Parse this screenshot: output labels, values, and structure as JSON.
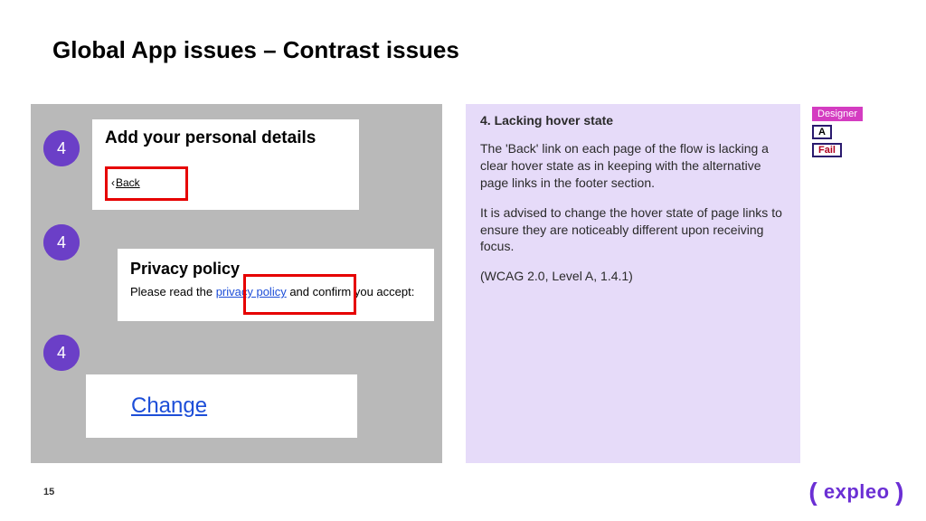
{
  "title": "Global App issues – Contrast issues",
  "pageNumber": "15",
  "logoText": "expleo",
  "badges": {
    "b1": "4",
    "b2": "4",
    "b3": "4"
  },
  "example1": {
    "heading": "Add your personal details",
    "backLabel": "Back"
  },
  "example2": {
    "heading": "Privacy policy",
    "prefix": "Please read the ",
    "link": "privacy policy",
    "suffix": " and confirm you accept:"
  },
  "example3": {
    "link": "Change"
  },
  "issue": {
    "heading": "4. Lacking hover state",
    "p1": "The 'Back' link on each page of the flow is lacking a clear hover state as in keeping with the alternative page links in the footer section.",
    "p2": "It is advised to change the hover state of page links to ensure they are noticeably different upon receiving focus.",
    "p3": "(WCAG 2.0, Level A, 1.4.1)"
  },
  "tags": {
    "designer": "Designer",
    "level": "A",
    "status": "Fail"
  }
}
